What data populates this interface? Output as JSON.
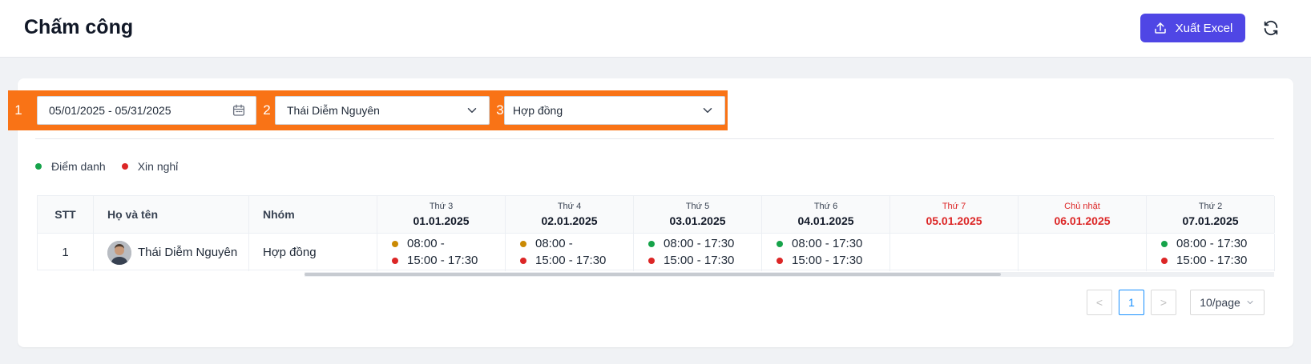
{
  "header": {
    "title": "Chấm công",
    "export_label": "Xuất Excel",
    "accent_color": "#4f46e5"
  },
  "filters": [
    {
      "number": "1",
      "value": "05/01/2025 - 05/31/2025",
      "icon": "calendar-icon"
    },
    {
      "number": "2",
      "value": "Thái Diễm Nguyên",
      "icon": "chevron-down-icon"
    },
    {
      "number": "3",
      "value": "Hợp đồng",
      "icon": "chevron-down-icon"
    }
  ],
  "legend": [
    {
      "label": "Điểm danh",
      "color": "#16a34a"
    },
    {
      "label": "Xin nghỉ",
      "color": "#dc2626"
    }
  ],
  "table": {
    "columns": {
      "stt": "STT",
      "name": "Họ và tên",
      "group": "Nhóm"
    },
    "days": [
      {
        "name": "Thứ 3",
        "date": "01.01.2025",
        "weekend": false
      },
      {
        "name": "Thứ 4",
        "date": "02.01.2025",
        "weekend": false
      },
      {
        "name": "Thứ 5",
        "date": "03.01.2025",
        "weekend": false
      },
      {
        "name": "Thứ 6",
        "date": "04.01.2025",
        "weekend": false
      },
      {
        "name": "Thứ 7",
        "date": "05.01.2025",
        "weekend": true
      },
      {
        "name": "Chủ nhật",
        "date": "06.01.2025",
        "weekend": true
      },
      {
        "name": "Thứ 2",
        "date": "07.01.2025",
        "weekend": false
      }
    ],
    "rows": [
      {
        "stt": "1",
        "name": "Thái Diễm Nguyên",
        "group": "Hợp đồng",
        "cells": [
          [
            {
              "color": "orange",
              "text": "08:00 -"
            },
            {
              "color": "red",
              "text": "15:00 - 17:30"
            }
          ],
          [
            {
              "color": "orange",
              "text": "08:00 -"
            },
            {
              "color": "red",
              "text": "15:00 - 17:30"
            }
          ],
          [
            {
              "color": "green",
              "text": "08:00 - 17:30"
            },
            {
              "color": "red",
              "text": "15:00 - 17:30"
            }
          ],
          [
            {
              "color": "green",
              "text": "08:00 - 17:30"
            },
            {
              "color": "red",
              "text": "15:00 - 17:30"
            }
          ],
          [],
          [],
          [
            {
              "color": "green",
              "text": "08:00 - 17:30"
            },
            {
              "color": "red",
              "text": "15:00 - 17:30"
            }
          ]
        ]
      }
    ]
  },
  "pagination": {
    "prev": "<",
    "current": "1",
    "next": ">",
    "page_size": "10/page"
  }
}
